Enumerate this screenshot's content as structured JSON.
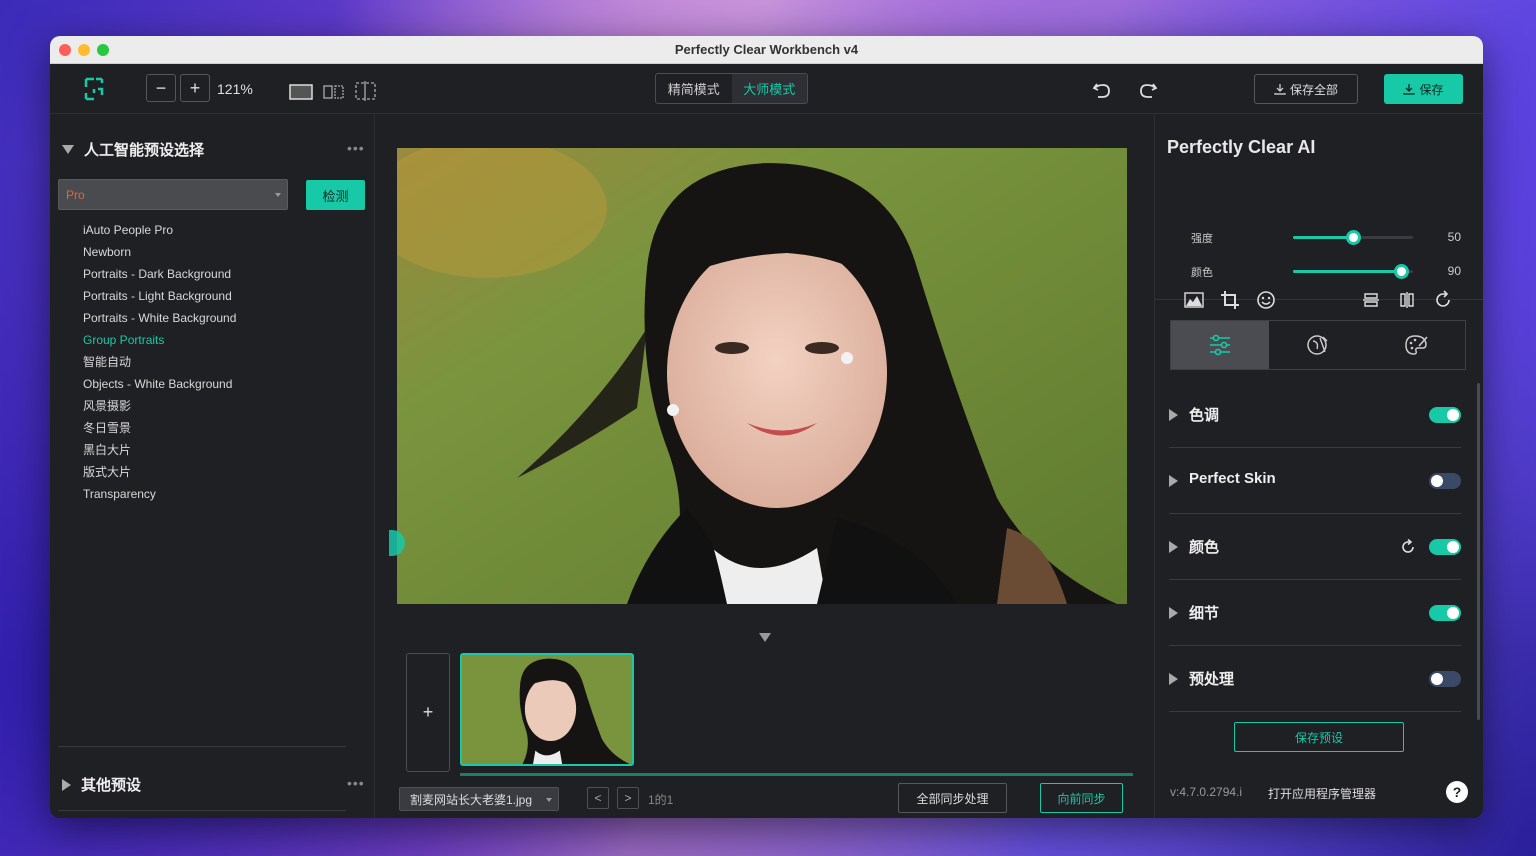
{
  "window": {
    "title": "Perfectly Clear Workbench v4"
  },
  "toolbar": {
    "zoom_minus": "−",
    "zoom_plus": "+",
    "zoom_level": "121%",
    "modes": [
      {
        "label": "精简模式",
        "active": false
      },
      {
        "label": "大师模式",
        "active": true
      }
    ],
    "save_all_label": "保存全部",
    "save_label": "保存"
  },
  "left_panel": {
    "ai_section_title": "人工智能预设选择",
    "more": "•••",
    "preset_select_value": "Pro",
    "detect_label": "检测",
    "presets": [
      {
        "label": "iAuto People Pro",
        "active": false
      },
      {
        "label": "Newborn",
        "active": false
      },
      {
        "label": "Portraits - Dark Background",
        "active": false
      },
      {
        "label": "Portraits - Light Background",
        "active": false
      },
      {
        "label": "Portraits - White Background",
        "active": false
      },
      {
        "label": "Group Portraits",
        "active": true
      },
      {
        "label": "智能自动",
        "active": false
      },
      {
        "label": "Objects - White Background",
        "active": false
      },
      {
        "label": "风景摄影",
        "active": false
      },
      {
        "label": "冬日雪景",
        "active": false
      },
      {
        "label": "黑白大片",
        "active": false
      },
      {
        "label": "版式大片",
        "active": false
      },
      {
        "label": "Transparency",
        "active": false
      }
    ],
    "other_section_title": "其他预设"
  },
  "center": {
    "add_label": "+",
    "file_name": "割麦网站长大老婆1.jpg",
    "prev": "<",
    "next": ">",
    "page_count": "1的1",
    "sync_all_label": "全部同步处理",
    "sync_forward_label": "向前同步"
  },
  "right_panel": {
    "title": "Perfectly Clear AI",
    "sliders": [
      {
        "label": "强度",
        "value": "50",
        "fraction": 0.5
      },
      {
        "label": "颜色",
        "value": "90",
        "fraction": 0.9
      }
    ],
    "adjustments": [
      {
        "label": "色调",
        "on": true,
        "reset": false
      },
      {
        "label": "Perfect Skin",
        "on": false,
        "reset": false
      },
      {
        "label": "颜色",
        "on": true,
        "reset": true
      },
      {
        "label": "细节",
        "on": true,
        "reset": false
      },
      {
        "label": "预处理",
        "on": false,
        "reset": false
      }
    ],
    "save_preset_label": "保存预设",
    "version": "v:4.7.0.2794.i",
    "app_manager_label": "打开应用程序管理器",
    "help": "?"
  },
  "colors": {
    "accent": "#18c9a8",
    "preset_select_text": "#e7633a"
  }
}
